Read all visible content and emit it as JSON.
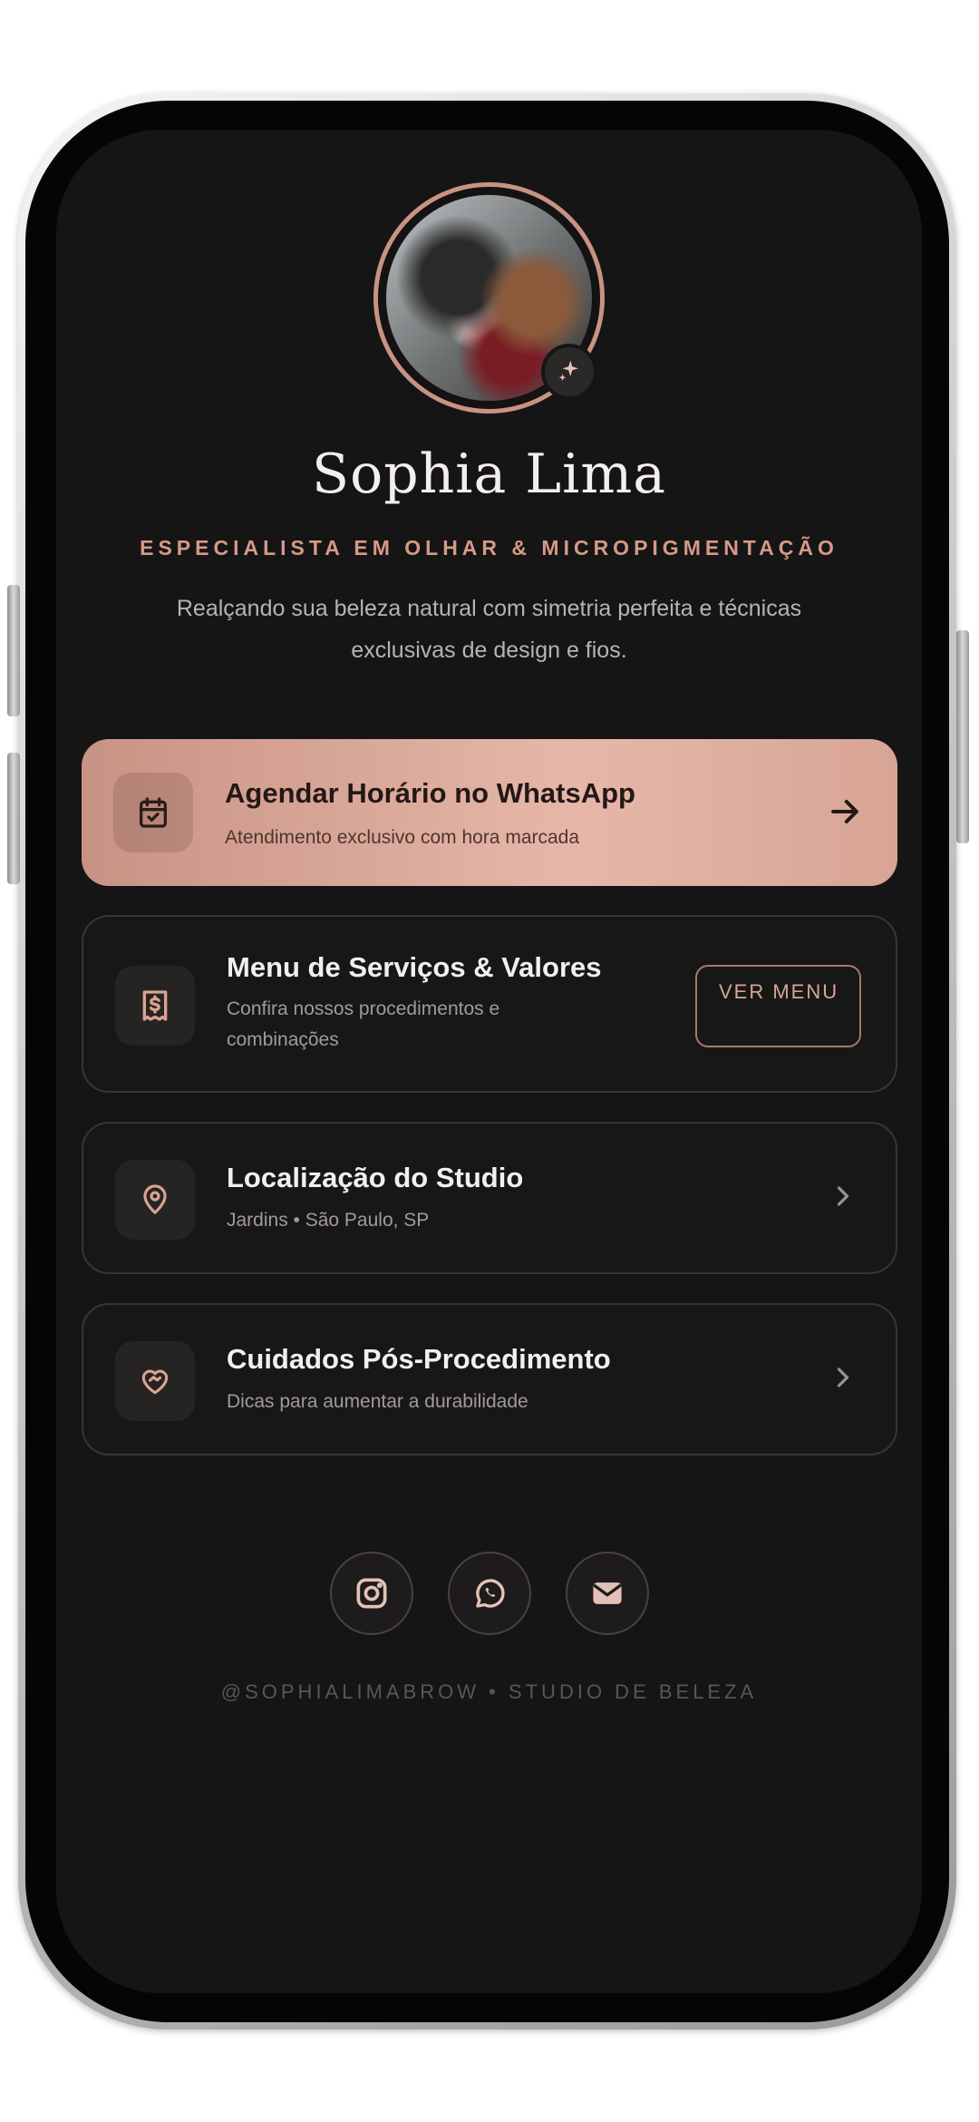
{
  "profile": {
    "name": "Sophia Lima",
    "subtitle": "ESPECIALISTA EM OLHAR & MICROPIGMENTAÇÃO",
    "tagline": "Realçando sua beleza natural com simetria perfeita e técnicas exclusivas de design e fios."
  },
  "links": {
    "whatsapp": {
      "title": "Agendar Horário no WhatsApp",
      "subtitle": "Atendimento exclusivo com hora marcada",
      "icon": "calendar-check-icon"
    },
    "menu": {
      "title": "Menu de Serviços & Valores",
      "subtitle": "Confira nossos procedimentos e combinações",
      "button": "VER MENU",
      "icon": "receipt-dollar-icon"
    },
    "location": {
      "title": "Localização do Studio",
      "subtitle": "Jardins • São Paulo, SP",
      "icon": "map-pin-icon"
    },
    "care": {
      "title": "Cuidados Pós-Procedimento",
      "subtitle": "Dicas para aumentar a durabilidade",
      "icon": "heart-handshake-icon"
    }
  },
  "socials": [
    "instagram-icon",
    "whatsapp-icon",
    "mail-icon"
  ],
  "footer": "@SOPHIALIMABROW • STUDIO DE BELEZA",
  "colors": {
    "accent": "#d59a86",
    "background": "#161515",
    "primary_button": "#e0ad9f"
  }
}
